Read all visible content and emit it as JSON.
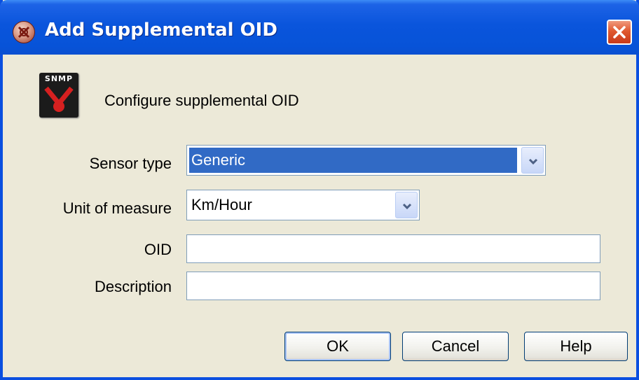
{
  "window": {
    "title": "Add Supplemental OID",
    "close_label": "Close"
  },
  "header": {
    "icon_text": "SNMP",
    "text": "Configure supplemental OID"
  },
  "form": {
    "sensor_type": {
      "label": "Sensor type",
      "value": "Generic"
    },
    "unit_of_measure": {
      "label": "Unit of measure",
      "value": "Km/Hour"
    },
    "oid": {
      "label": "OID",
      "value": ""
    },
    "description": {
      "label": "Description",
      "value": ""
    }
  },
  "buttons": {
    "ok": "OK",
    "cancel": "Cancel",
    "help": "Help"
  },
  "colors": {
    "titlebar": "#0a55dc",
    "selection": "#316ac5",
    "dialog_bg": "#ece9d8",
    "close_button": "#e0592f"
  },
  "icons": {
    "title": "app-logo-icon",
    "header": "snmp-icon",
    "close": "close-icon",
    "dropdown": "chevron-down-icon"
  }
}
